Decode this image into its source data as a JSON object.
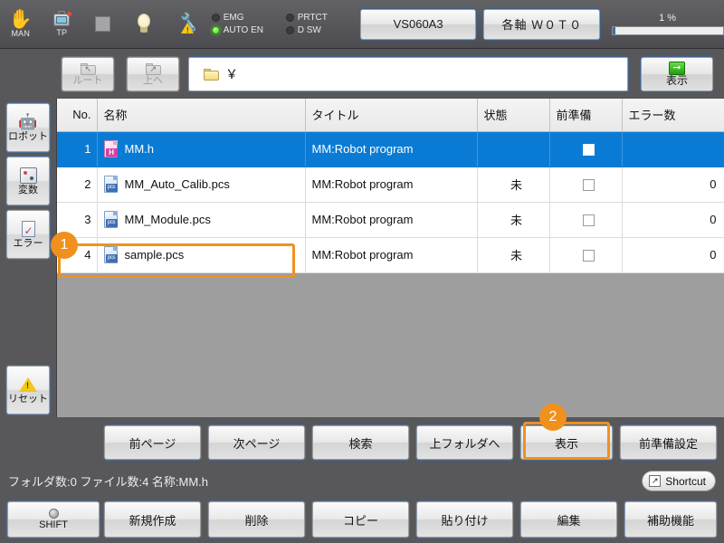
{
  "topbar": {
    "mode_label": "MAN",
    "tp_label": "TP",
    "leds": [
      {
        "name": "EMG",
        "on": false
      },
      {
        "name": "PRTCT",
        "on": false
      },
      {
        "name": "AUTO EN",
        "on": true
      },
      {
        "name": "D SW",
        "on": false
      }
    ],
    "model_button": "VS060A3",
    "axis_button": "各軸 Ｗ０Ｔ０",
    "speed_percent": "1 %",
    "speed_value": 1
  },
  "pathbar": {
    "root_button": "ルート",
    "up_button": "上へ",
    "path_value": "￥",
    "show_button": "表示"
  },
  "sidebar": {
    "items": [
      {
        "label": "ロボット",
        "icon": "robot-icon"
      },
      {
        "label": "変数",
        "icon": "variable-icon"
      },
      {
        "label": "エラー",
        "icon": "error-icon"
      }
    ],
    "reset": {
      "label": "リセット",
      "icon": "warning-triangle-icon"
    }
  },
  "table": {
    "headers": [
      "No.",
      "名称",
      "タイトル",
      "状態",
      "前準備",
      "エラー数"
    ],
    "rows": [
      {
        "no": "1",
        "icon": "h-file-icon",
        "icon_tag": "H",
        "name": "MM.h",
        "title": "MM:Robot program",
        "state": "",
        "prep": false,
        "errors": "",
        "selected": true
      },
      {
        "no": "2",
        "icon": "pcs-file-icon",
        "icon_tag": "pcs",
        "name": "MM_Auto_Calib.pcs",
        "title": "MM:Robot program",
        "state": "未",
        "prep": false,
        "errors": "0",
        "selected": false
      },
      {
        "no": "3",
        "icon": "pcs-file-icon",
        "icon_tag": "pcs",
        "name": "MM_Module.pcs",
        "title": "MM:Robot program",
        "state": "未",
        "prep": false,
        "errors": "0",
        "selected": false
      },
      {
        "no": "4",
        "icon": "pcs-file-icon",
        "icon_tag": "pcs",
        "name": "sample.pcs",
        "title": "MM:Robot program",
        "state": "未",
        "prep": false,
        "errors": "0",
        "selected": false
      }
    ]
  },
  "annotations": [
    {
      "number": "1",
      "target": "table-row-4"
    },
    {
      "number": "2",
      "target": "function-button-show"
    }
  ],
  "functions": [
    {
      "label": "前ページ"
    },
    {
      "label": "次ページ"
    },
    {
      "label": "検索"
    },
    {
      "label": "上フォルダへ"
    },
    {
      "label": "表示"
    },
    {
      "label": "前準備設定"
    }
  ],
  "status": {
    "text": "フォルダ数:0 ファイル数:4 名称:MM.h",
    "shortcut_label": "Shortcut"
  },
  "keys": [
    {
      "label": "SHIFT",
      "type": "shift"
    },
    {
      "label": "新規作成",
      "type": "normal"
    },
    {
      "label": "削除",
      "type": "normal"
    },
    {
      "label": "コピー",
      "type": "normal"
    },
    {
      "label": "貼り付け",
      "type": "normal"
    },
    {
      "label": "編集",
      "type": "normal"
    },
    {
      "label": "補助機能",
      "type": "normal"
    }
  ],
  "colors": {
    "accent_selection": "#0a7bd4",
    "annotation": "#f0911e",
    "led_on": "#2fd71a",
    "panel_bg": "#58585a"
  }
}
